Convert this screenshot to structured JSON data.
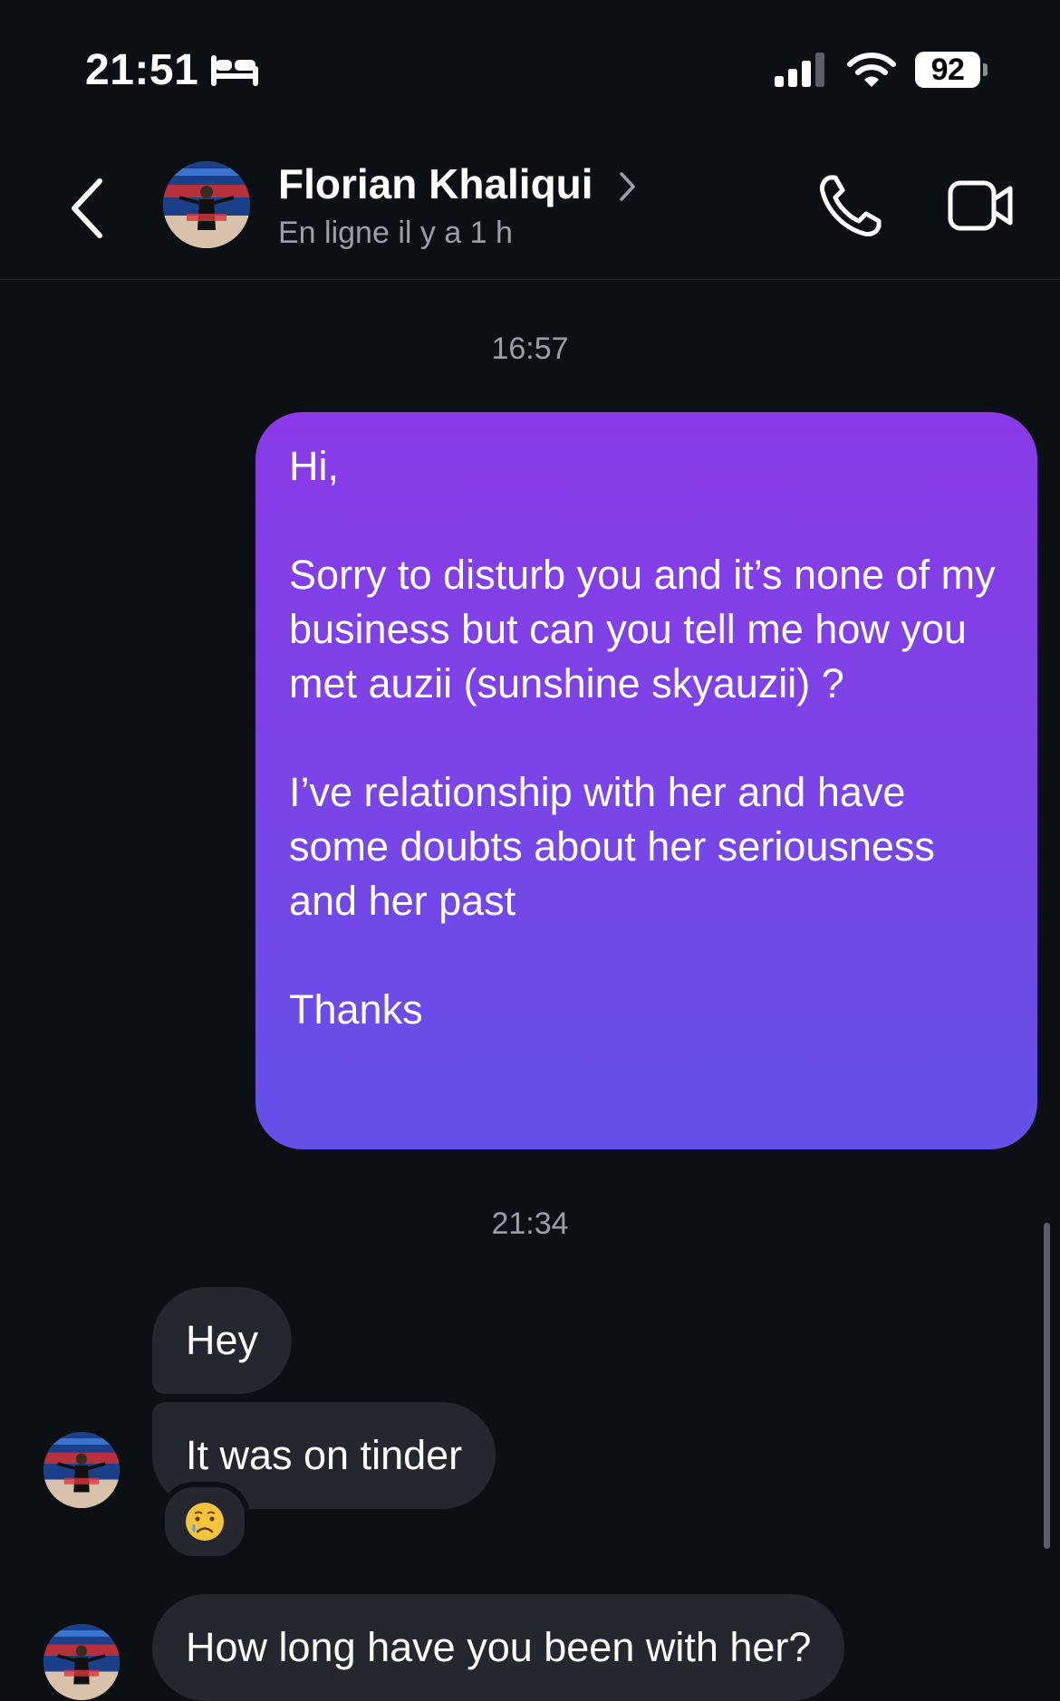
{
  "status_bar": {
    "time": "21:51",
    "battery": "92",
    "icons": [
      "bed-icon",
      "signal-icon",
      "wifi-icon",
      "battery-icon"
    ]
  },
  "header": {
    "contact_name": "Florian Khaliqui",
    "status": "En ligne il y a 1 h",
    "icons": [
      "back-chevron-icon",
      "chevron-right-icon",
      "phone-icon",
      "video-camera-icon"
    ]
  },
  "messages": {
    "timestamp_1": "16:57",
    "outgoing_1": "Hi,\n\nSorry to disturb you and it’s none of my business but can you tell me how you met auzii (sunshine skyauzii) ?\n\nI’ve relationship with her and have some doubts about her seriousness and her past\n\nThanks",
    "timestamp_2": "21:34",
    "incoming_1": "Hey",
    "incoming_2": "It was on tinder",
    "incoming_2_reaction": "😢",
    "incoming_3": "How long have you been with her?"
  },
  "colors": {
    "background": "#0c0f14",
    "outgoing_gradient_top": "#8a3ae8",
    "outgoing_gradient_bottom": "#6350e8",
    "incoming_bubble": "#24272d",
    "secondary_text": "#9a9ea6"
  }
}
